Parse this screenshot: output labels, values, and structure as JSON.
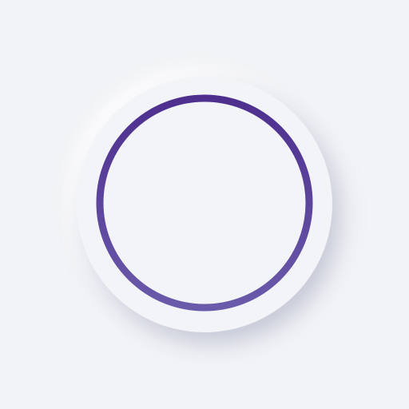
{
  "colors": {
    "background": "#f2f3f6",
    "disc": "#f3f4f7",
    "ring_top": "#4e2f8e",
    "ring_bottom": "#6a5aaa"
  },
  "icon": {
    "name": "circle-ring-icon"
  }
}
